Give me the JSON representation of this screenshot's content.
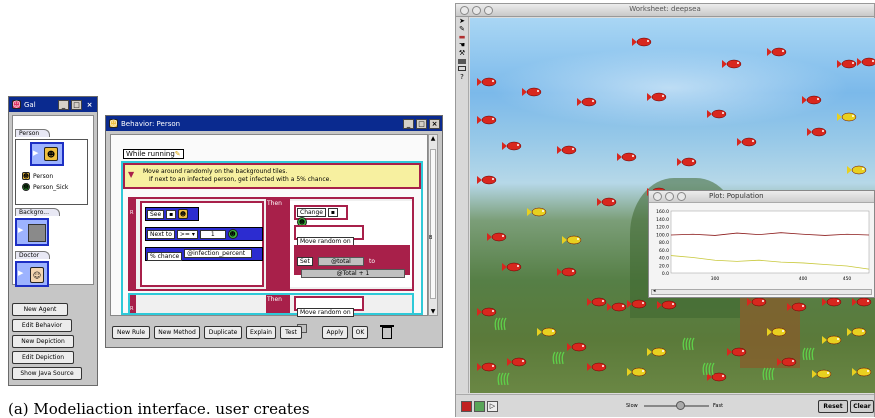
{
  "gallery": {
    "title": "Gal",
    "agents": [
      {
        "tab": "Person",
        "items": [
          "Person",
          "Person_Sick"
        ]
      },
      {
        "tab": "Backgro..."
      },
      {
        "tab": "Doctor"
      }
    ],
    "buttons": [
      "New Agent",
      "Edit Behavior",
      "New Depiction",
      "Edit Depiction",
      "Show Java Source"
    ]
  },
  "behavior": {
    "title": "Behavior: Person",
    "method": "While running",
    "comment_line1": "Move around randomly on the background tiles.",
    "comment_line2": "If next to an infected person, get infected with a 5% chance.",
    "then1": "Then",
    "then2": "Then",
    "see_label": "See",
    "next_to_label": "Next to",
    "next_to_op": ">=",
    "next_to_value": "1",
    "chance_label": "% chance",
    "chance_var": "@infection_percent",
    "change_label": "Change",
    "move_random_label": "Move random on",
    "set_label": "Set",
    "set_var": "@total",
    "set_to": "to",
    "set_expr": "@Total + 1",
    "move_random_label2": "Move random on",
    "rule_letter1": "R",
    "rule_letter2": "R",
    "side_letter": "B",
    "buttons": [
      "New Rule",
      "New Method",
      "Duplicate",
      "Explain",
      "Test"
    ],
    "apply": "Apply",
    "ok": "OK"
  },
  "caption": "(a)  Modeliaction  interface.  user  creates",
  "worksheet": {
    "title": "Worksheet: deepsea",
    "tools": [
      "Σ",
      "?"
    ],
    "slider_slow": "Slow",
    "slider_fast": "Fast",
    "reset": "Reset",
    "clear": "Clear",
    "speed_level": 0.55
  },
  "plot": {
    "title": "Plot: Population",
    "chart_data": {
      "type": "line",
      "yticks": [
        "160.0",
        "140.0",
        "120.0",
        "100.0",
        "80.0",
        "60.0",
        "40.0",
        "20.0",
        "0.0"
      ],
      "xticks": [
        "300",
        "400",
        "450"
      ],
      "ylim": [
        0,
        160
      ],
      "xlim": [
        250,
        475
      ],
      "series": [
        {
          "color": "#8b1a1a",
          "x": [
            250,
            275,
            300,
            325,
            350,
            375,
            400,
            425,
            450,
            475
          ],
          "values": [
            98,
            100,
            97,
            103,
            99,
            104,
            100,
            97,
            100,
            98
          ]
        },
        {
          "color": "#c8c83a",
          "x": [
            250,
            275,
            300,
            325,
            350,
            375,
            400,
            425,
            450,
            475
          ],
          "values": [
            45,
            40,
            33,
            30,
            33,
            28,
            26,
            22,
            18,
            10
          ]
        }
      ]
    }
  },
  "colors": {
    "fish": "#d8271e",
    "fish_yellow": "#e8d020",
    "win_title": "#0a2a8f",
    "rule_border": "#a8204a"
  }
}
